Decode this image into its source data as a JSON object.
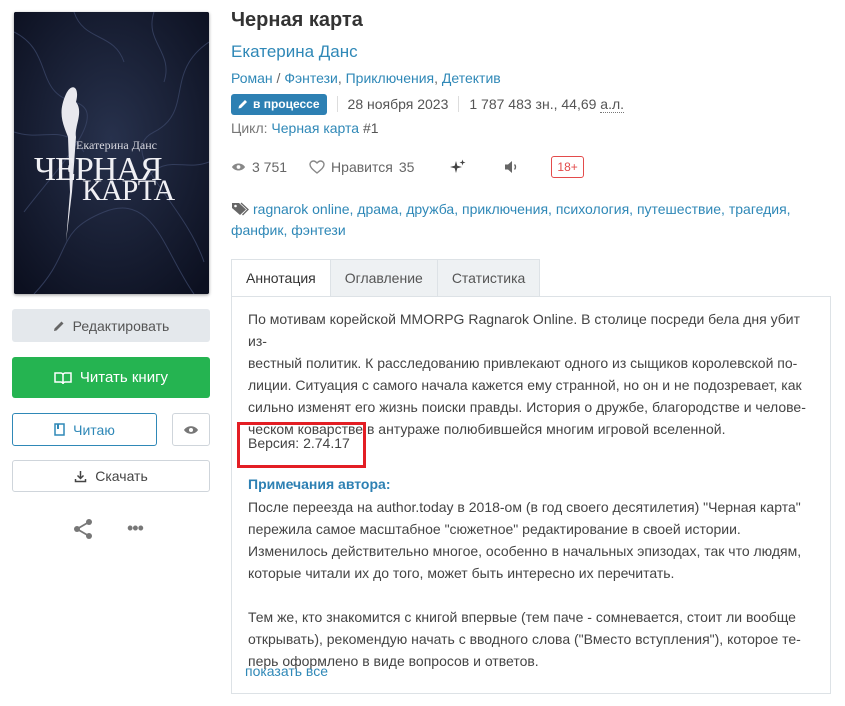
{
  "book": {
    "title": "Черная карта",
    "author": "Екатерина Данс",
    "genres": [
      "Роман",
      "Фэнтези",
      "Приключения",
      "Детектив"
    ],
    "status_badge": "в процессе",
    "date": "28 ноября 2023",
    "size": "1 787 483 зн., 44,69",
    "size_unit": "а.л.",
    "cycle_label": "Цикл:",
    "cycle_name": "Черная карта",
    "cycle_num": "#1",
    "cover": {
      "author_text": "Екатерина Данс",
      "title_line1": "ЧЕРНАЯ",
      "title_line2": "КАРТА"
    }
  },
  "stats": {
    "views": "3 751",
    "likes_label": "Нравится",
    "likes": "35",
    "age_rating": "18+"
  },
  "tags": [
    "ragnarok online",
    "драма",
    "дружба",
    "приключения",
    "психология",
    "путешествие",
    "трагедия",
    "фанфик",
    "фэнтези"
  ],
  "actions": {
    "edit": "Редактировать",
    "read": "Читать книгу",
    "reading": "Читаю",
    "download": "Скачать"
  },
  "tabs": [
    "Аннотация",
    "Оглавление",
    "Статистика"
  ],
  "annotation": {
    "text_lines": [
      "По мотивам корейской MMORPG Ragnarok Online. В столице посреди бела дня убит из-",
      "вестный политик. К расследованию привлекают одного из сыщиков королевской по-",
      "лиции. Ситуация с самого начала кажется ему странной, но он и не подозревает, как",
      "сильно изменят его жизнь поиски правды. История о дружбе, благородстве и челове-",
      "ческом коварстве в антураже полюбившейся многим игровой вселенной."
    ],
    "version": "Версия: 2.74.17",
    "notes_title": "Примечания автора:",
    "notes_p1": [
      "После переезда на author.today в 2018-ом (в год своего десятилетия) \"Черная карта\"",
      "пережила самое масштабное \"сюжетное\" редактирование в своей истории.",
      "Изменилось действительно многое, особенно в начальных эпизодах, так что людям,",
      "которые читали их до того, может быть интересно их перечитать."
    ],
    "notes_p2": [
      "Тем же, кто знакомится с книгой впервые (тем паче - сомневается, стоит ли вообще",
      "открывать), рекомендую начать с вводного слова (\"Вместо вступления\"), которое те-",
      "перь оформлено в виде вопросов и ответов."
    ],
    "show_all": "показать все"
  }
}
